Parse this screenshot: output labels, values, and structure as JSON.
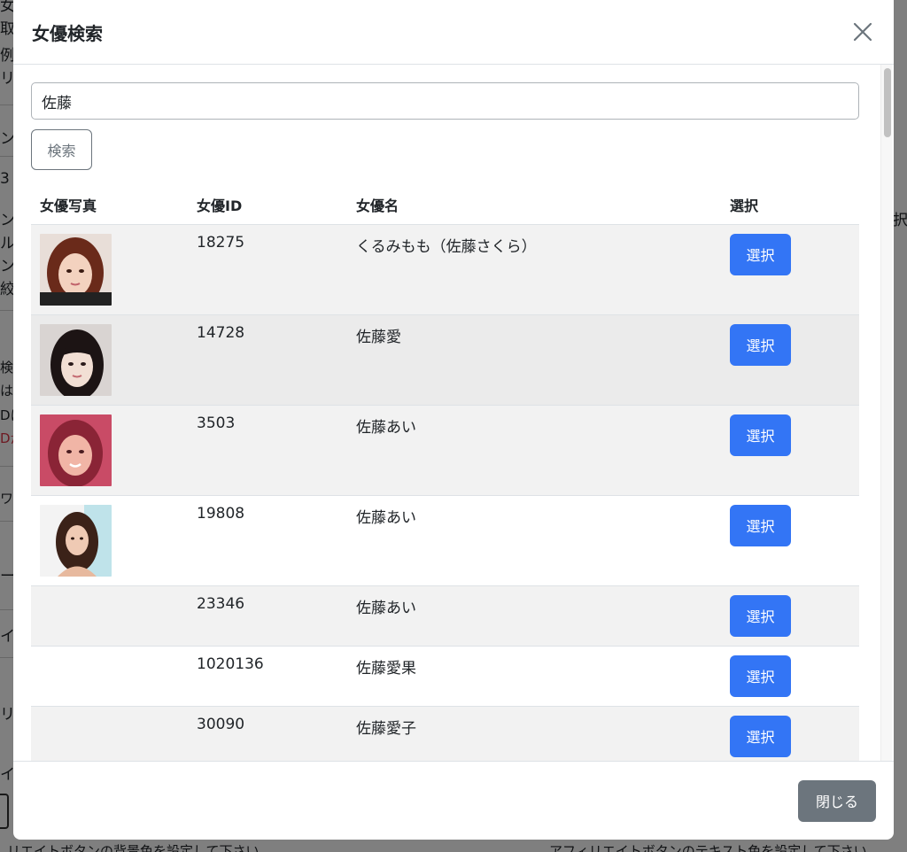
{
  "modal": {
    "title": "女優検索",
    "search": {
      "value": "佐藤"
    },
    "search_button_label": "検索",
    "columns": [
      "女優写真",
      "女優ID",
      "女優名",
      "選択"
    ],
    "rows": [
      {
        "id": "18275",
        "name": "くるみもも（佐藤さくら）",
        "select_label": "選択",
        "has_photo": true
      },
      {
        "id": "14728",
        "name": "佐藤愛",
        "select_label": "選択",
        "has_photo": true
      },
      {
        "id": "3503",
        "name": "佐藤あい",
        "select_label": "選択",
        "has_photo": true
      },
      {
        "id": "19808",
        "name": "佐藤あい",
        "select_label": "選択",
        "has_photo": true
      },
      {
        "id": "23346",
        "name": "佐藤あい",
        "select_label": "選択",
        "has_photo": false
      },
      {
        "id": "1020136",
        "name": "佐藤愛果",
        "select_label": "選択",
        "has_photo": false
      },
      {
        "id": "30090",
        "name": "佐藤愛子",
        "select_label": "選択",
        "has_photo": false
      }
    ],
    "close_button_label": "閉じる",
    "colors": {
      "primary": "#3375f5",
      "secondary": "#6c757d",
      "stripe": "#f2f2f2"
    },
    "icons": {
      "close": "close-icon"
    }
  },
  "background": {
    "fragments": [
      "女",
      "取",
      "例.",
      "リ",
      "ンバ",
      "3",
      "ン",
      "ル",
      "ンバ",
      "絞り",
      "検",
      "は",
      "Dに",
      "Dが",
      "ワー",
      "ー",
      "イ",
      "リ",
      "イリ",
      "択"
    ],
    "footer_left": "リエイトボタンの背景色を設定して下さい",
    "footer_right": "アフィリエイトボタンのテキスト色を設定して下さい"
  }
}
